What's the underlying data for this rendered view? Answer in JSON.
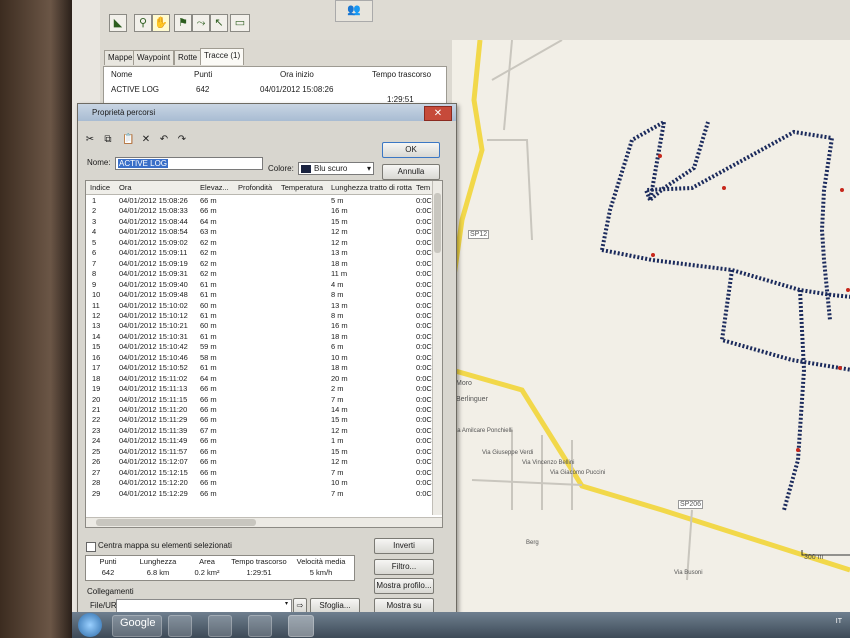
{
  "toolbar": {
    "buttons": [
      "select-icon",
      "zoom-icon",
      "hand-icon",
      "flag-icon",
      "route-icon",
      "pointer-icon",
      "measure-icon"
    ]
  },
  "left_panel": {
    "tabs": [
      "Mappe",
      "Waypoint",
      "Rotte",
      "Tracce (1)"
    ],
    "tracks_header": [
      "Nome",
      "Punti",
      "Ora inizio",
      "Tempo trascorso"
    ],
    "track": {
      "name": "ACTIVE LOG",
      "points": "642",
      "start": "04/01/2012 15:08:26",
      "elapsed": "1:29:51"
    }
  },
  "dialog": {
    "title": "Proprietà percorsi",
    "name_label": "Nome:",
    "name_value": "ACTIVE LOG",
    "color_label": "Colore:",
    "color_value": "Blu scuro",
    "ok_label": "OK",
    "cancel_label": "Annulla",
    "columns": [
      "Indice",
      "Ora",
      "Elevaz...",
      "Profondità",
      "Temperatura",
      "Lunghezza tratto di rotta",
      "Tem"
    ],
    "rows": [
      [
        "1",
        "04/01/2012 15:08:26",
        "66 m",
        "5 m",
        "0:0C"
      ],
      [
        "2",
        "04/01/2012 15:08:33",
        "66 m",
        "16 m",
        "0:0C"
      ],
      [
        "3",
        "04/01/2012 15:08:44",
        "64 m",
        "15 m",
        "0:0C"
      ],
      [
        "4",
        "04/01/2012 15:08:54",
        "63 m",
        "12 m",
        "0:0C"
      ],
      [
        "5",
        "04/01/2012 15:09:02",
        "62 m",
        "12 m",
        "0:0C"
      ],
      [
        "6",
        "04/01/2012 15:09:11",
        "62 m",
        "13 m",
        "0:0C"
      ],
      [
        "7",
        "04/01/2012 15:09:19",
        "62 m",
        "18 m",
        "0:0C"
      ],
      [
        "8",
        "04/01/2012 15:09:31",
        "62 m",
        "11 m",
        "0:0C"
      ],
      [
        "9",
        "04/01/2012 15:09:40",
        "61 m",
        "4 m",
        "0:0C"
      ],
      [
        "10",
        "04/01/2012 15:09:48",
        "61 m",
        "8 m",
        "0:0C"
      ],
      [
        "11",
        "04/01/2012 15:10:02",
        "60 m",
        "13 m",
        "0:0C"
      ],
      [
        "12",
        "04/01/2012 15:10:12",
        "61 m",
        "8 m",
        "0:0C"
      ],
      [
        "13",
        "04/01/2012 15:10:21",
        "60 m",
        "16 m",
        "0:0C"
      ],
      [
        "14",
        "04/01/2012 15:10:31",
        "61 m",
        "18 m",
        "0:0C"
      ],
      [
        "15",
        "04/01/2012 15:10:42",
        "59 m",
        "6 m",
        "0:0C"
      ],
      [
        "16",
        "04/01/2012 15:10:46",
        "58 m",
        "10 m",
        "0:0C"
      ],
      [
        "17",
        "04/01/2012 15:10:52",
        "61 m",
        "18 m",
        "0:0C"
      ],
      [
        "18",
        "04/01/2012 15:11:02",
        "64 m",
        "20 m",
        "0:0C"
      ],
      [
        "19",
        "04/01/2012 15:11:13",
        "66 m",
        "2 m",
        "0:0C"
      ],
      [
        "20",
        "04/01/2012 15:11:15",
        "66 m",
        "7 m",
        "0:0C"
      ],
      [
        "21",
        "04/01/2012 15:11:20",
        "66 m",
        "14 m",
        "0:0C"
      ],
      [
        "22",
        "04/01/2012 15:11:29",
        "66 m",
        "15 m",
        "0:0C"
      ],
      [
        "23",
        "04/01/2012 15:11:39",
        "67 m",
        "12 m",
        "0:0C"
      ],
      [
        "24",
        "04/01/2012 15:11:49",
        "66 m",
        "1 m",
        "0:0C"
      ],
      [
        "25",
        "04/01/2012 15:11:57",
        "66 m",
        "15 m",
        "0:0C"
      ],
      [
        "26",
        "04/01/2012 15:12:07",
        "66 m",
        "12 m",
        "0:0C"
      ],
      [
        "27",
        "04/01/2012 15:12:15",
        "66 m",
        "7 m",
        "0:0C"
      ],
      [
        "28",
        "04/01/2012 15:12:20",
        "66 m",
        "10 m",
        "0:0C"
      ],
      [
        "29",
        "04/01/2012 15:12:29",
        "66 m",
        "7 m",
        "0:0C"
      ]
    ],
    "center_map_label": "Centra mappa su elementi selezionati",
    "invert_label": "Inverti",
    "filter_label": "Filtro...",
    "profile_label": "Mostra profilo...",
    "show_map_label": "Mostra su mappa",
    "summary_headers": [
      "Punti",
      "Lunghezza",
      "Area",
      "Tempo trascorso",
      "Velocità media"
    ],
    "summary_values": [
      "642",
      "6.8 km",
      "0.2 km²",
      "1:29:51",
      "5 km/h"
    ],
    "links_label": "Collegamenti",
    "file_label": "File/URL:",
    "browse_label": "Sfoglia..."
  },
  "map": {
    "labels": [
      "SP12",
      "SP206",
      "300 m",
      "Moro",
      "Berlinguer",
      "Via Amilcare Ponchielli",
      "Via Giuseppe Verdi",
      "Via Vincenzo Bellini",
      "Via Giacomo Puccini",
      "Via Busoni",
      "Berg"
    ]
  },
  "taskbar": {
    "google_label": "Google",
    "tray_lang": "IT"
  },
  "colors": {
    "track": "#1b2a5c",
    "road": "#f2d84a",
    "waypoint": "#c7281c"
  }
}
